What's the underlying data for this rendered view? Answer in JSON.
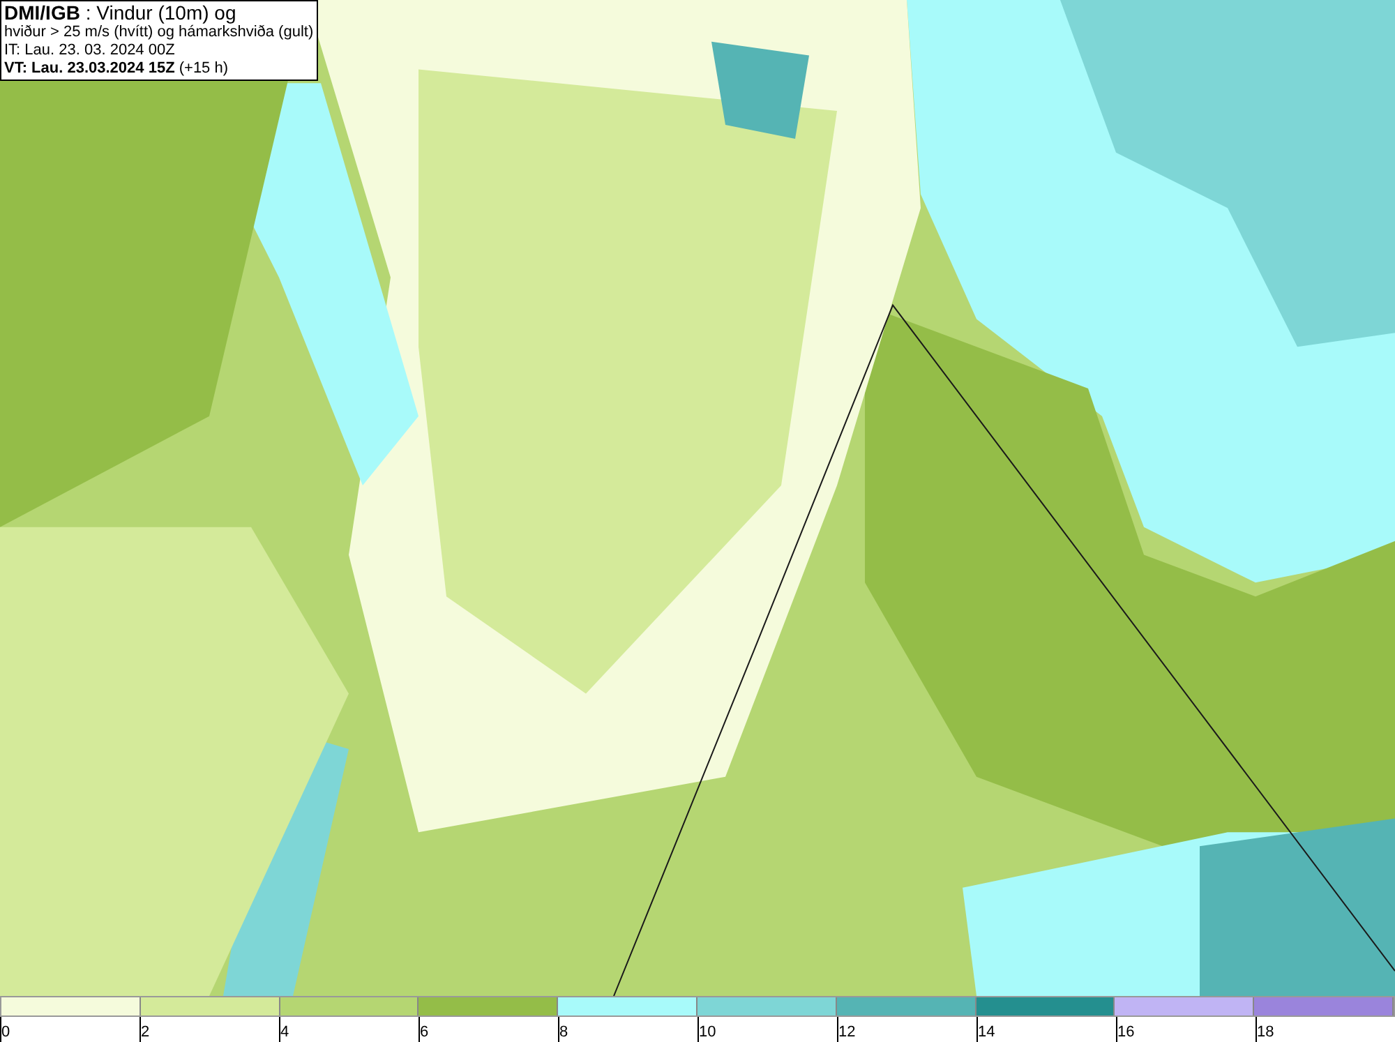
{
  "header": {
    "lines": [
      "**DMI/IGB** : Vindur (10m) og",
      "hviður > 25 m/s (hvítt) og hámarkshviða (gult)",
      "IT: Lau. 23. 03. 2024 00Z",
      "**VT: Lau. 23.03.2024 15Z** (+15 h)"
    ]
  },
  "legend": {
    "segments": [
      {
        "color": "#f5fbdc",
        "label": "0"
      },
      {
        "color": "#d4ea9a",
        "label": "2"
      },
      {
        "color": "#b5d672",
        "label": "4"
      },
      {
        "color": "#94bd48",
        "label": "6"
      },
      {
        "color": "#a8fafa",
        "label": "8"
      },
      {
        "color": "#7ed6d6",
        "label": "10"
      },
      {
        "color": "#55b4b4",
        "label": "12"
      },
      {
        "color": "#248f8f",
        "label": "14"
      },
      {
        "color": "#c0b4f4",
        "label": "16"
      },
      {
        "color": "#9a84dc",
        "label": "18"
      }
    ]
  }
}
